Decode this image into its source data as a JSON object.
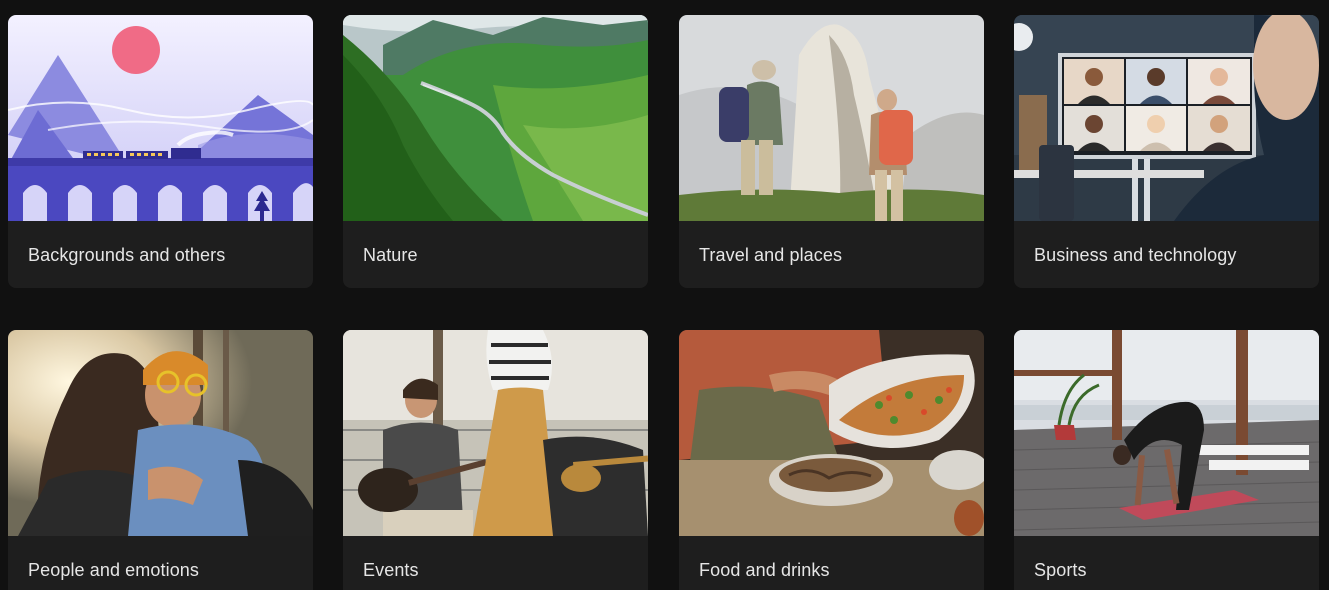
{
  "categories": [
    {
      "label": "Backgrounds and others",
      "image": "illustrated-train-viaduct-mountains"
    },
    {
      "label": "Nature",
      "image": "green-valley-river"
    },
    {
      "label": "Travel and places",
      "image": "hikers-mountain-view"
    },
    {
      "label": "Business and technology",
      "image": "video-conference-screen"
    },
    {
      "label": "People and emotions",
      "image": "friends-hugging"
    },
    {
      "label": "Events",
      "image": "guitar-players-dancing"
    },
    {
      "label": "Food and drinks",
      "image": "pasta-serving"
    },
    {
      "label": "Sports",
      "image": "yoga-on-terrace"
    }
  ],
  "colors": {
    "background": "#111111",
    "card": "#1e1e1e",
    "label": "#e6e6e6"
  }
}
